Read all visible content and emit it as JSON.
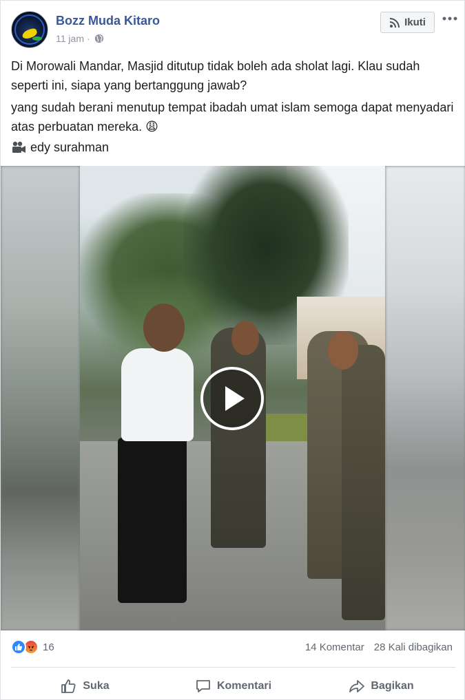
{
  "post": {
    "author": "Bozz Muda Kitaro",
    "time": "11 jam",
    "separator": "·",
    "privacy_icon": "globe-icon",
    "follow_label": "Ikuti",
    "more_icon": "more-options-icon",
    "paragraph_1": "Di Morowali Mandar, Masjid ditutup tidak boleh ada sholat lagi. Klau sudah seperti ini, siapa yang bertanggung jawab?",
    "paragraph_2": "yang sudah berani menutup tempat ibadah umat islam semoga dapat menyadari atas perbuatan mereka. 😩",
    "credit_icon": "video-camera-icon",
    "credit": "edy surahman"
  },
  "video": {
    "play_icon": "play-icon"
  },
  "footer": {
    "reaction_icons": [
      "like-reaction-icon",
      "angry-reaction-icon"
    ],
    "reaction_count": "16",
    "comments": "14 Komentar",
    "shares": "28 Kali dibagikan"
  },
  "actions": {
    "like": "Suka",
    "comment": "Komentari",
    "share": "Bagikan"
  },
  "colors": {
    "link": "#385898",
    "muted": "#90949c",
    "like_blue": "#2d88ff",
    "angry_red": "#e8413a"
  }
}
